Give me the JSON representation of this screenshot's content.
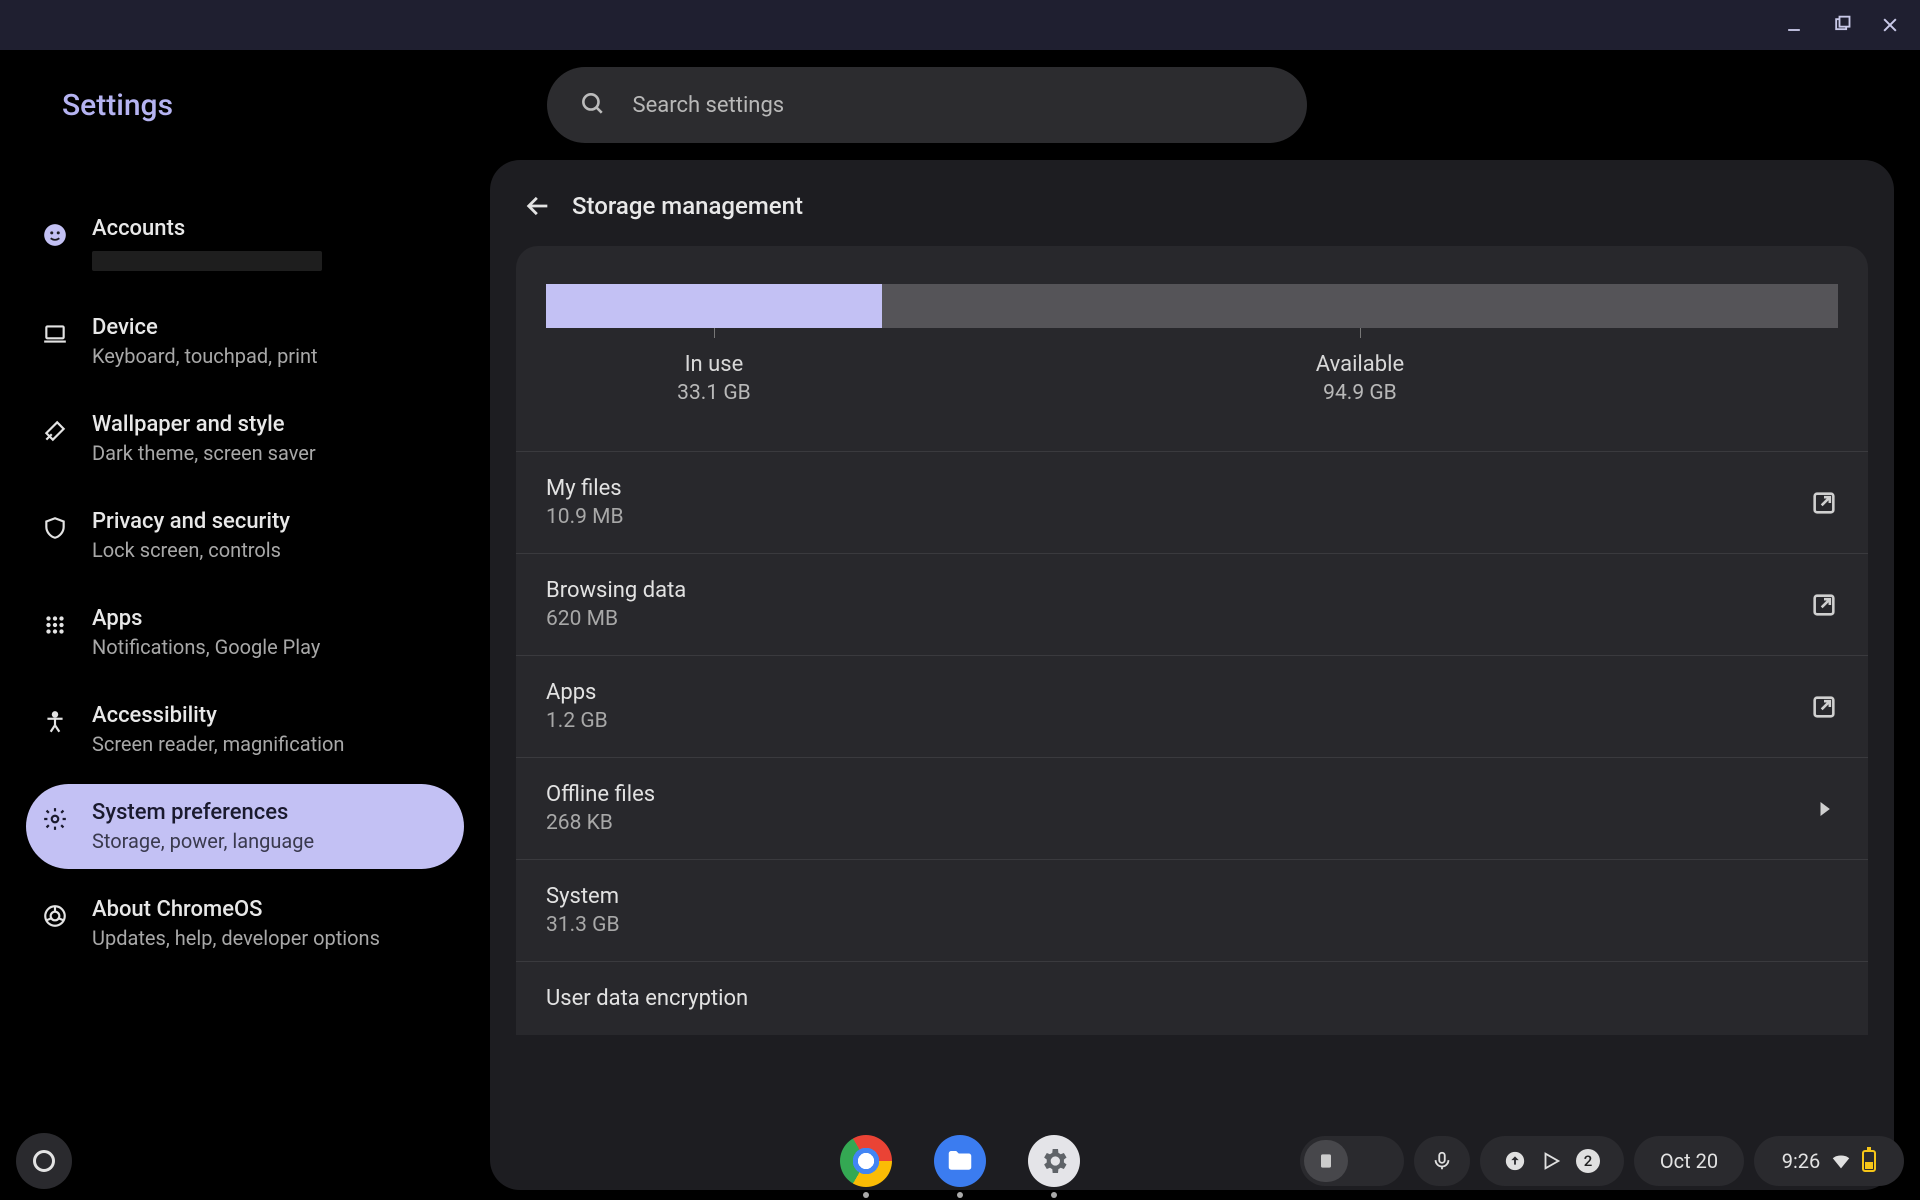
{
  "window": {
    "app_title": "Settings"
  },
  "search": {
    "placeholder": "Search settings"
  },
  "sidebar": {
    "items": [
      {
        "title": "Accounts",
        "sub": ""
      },
      {
        "title": "Device",
        "sub": "Keyboard, touchpad, print"
      },
      {
        "title": "Wallpaper and style",
        "sub": "Dark theme, screen saver"
      },
      {
        "title": "Privacy and security",
        "sub": "Lock screen, controls"
      },
      {
        "title": "Apps",
        "sub": "Notifications, Google Play"
      },
      {
        "title": "Accessibility",
        "sub": "Screen reader, magnification"
      },
      {
        "title": "System preferences",
        "sub": "Storage, power, language"
      },
      {
        "title": "About ChromeOS",
        "sub": "Updates, help, developer options"
      }
    ]
  },
  "panel": {
    "title": "Storage management"
  },
  "storage": {
    "in_use_label": "In use",
    "in_use_value": "33.1 GB",
    "available_label": "Available",
    "available_value": "94.9 GB",
    "used_percent": 26,
    "rows": [
      {
        "title": "My files",
        "sub": "10.9 MB",
        "action": "open"
      },
      {
        "title": "Browsing data",
        "sub": "620 MB",
        "action": "open"
      },
      {
        "title": "Apps",
        "sub": "1.2 GB",
        "action": "open"
      },
      {
        "title": "Offline files",
        "sub": "268 KB",
        "action": "expand"
      },
      {
        "title": "System",
        "sub": "31.3 GB",
        "action": "none"
      },
      {
        "title": "User data encryption",
        "sub": "",
        "action": "none"
      }
    ]
  },
  "tray": {
    "notification_count": "2",
    "date": "Oct 20",
    "time": "9:26"
  }
}
